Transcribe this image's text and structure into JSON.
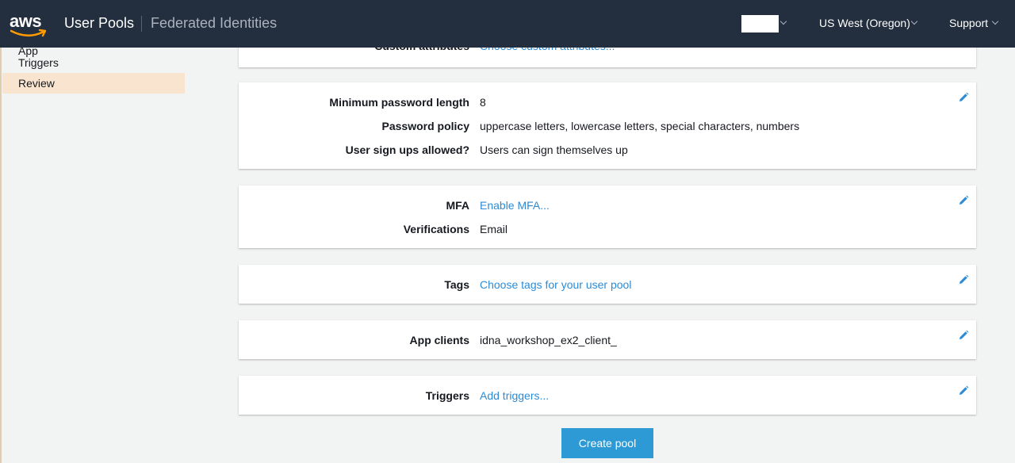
{
  "nav": {
    "logo_text": "aws",
    "primary": "User Pools",
    "secondary": "Federated Identities",
    "region": "US West (Oregon)",
    "support": "Support"
  },
  "sidebar": {
    "partial_item": "App",
    "items": [
      {
        "label": "Triggers",
        "active": false
      },
      {
        "label": "Review",
        "active": true
      }
    ]
  },
  "sections": {
    "attributes": {
      "label": "Custom attributes",
      "value": "Choose custom attributes..."
    },
    "policies": [
      {
        "label": "Minimum password length",
        "value": "8"
      },
      {
        "label": "Password policy",
        "value": "uppercase letters, lowercase letters, special characters, numbers"
      },
      {
        "label": "User sign ups allowed?",
        "value": "Users can sign themselves up"
      }
    ],
    "mfa": [
      {
        "label": "MFA",
        "value": "Enable MFA..."
      },
      {
        "label": "Verifications",
        "value": "Email"
      }
    ],
    "tags": {
      "label": "Tags",
      "value": "Choose tags for your user pool"
    },
    "app_clients": {
      "label": "App clients",
      "value": "idna_workshop_ex2_client_"
    },
    "triggers": {
      "label": "Triggers",
      "value": "Add triggers..."
    }
  },
  "actions": {
    "create": "Create pool"
  },
  "colors": {
    "nav_bg": "#232f3e",
    "link": "#2d8bd6",
    "button": "#2d9ad6",
    "active_sidebar": "#f9e5cf",
    "aws_smile": "#ff9900"
  }
}
